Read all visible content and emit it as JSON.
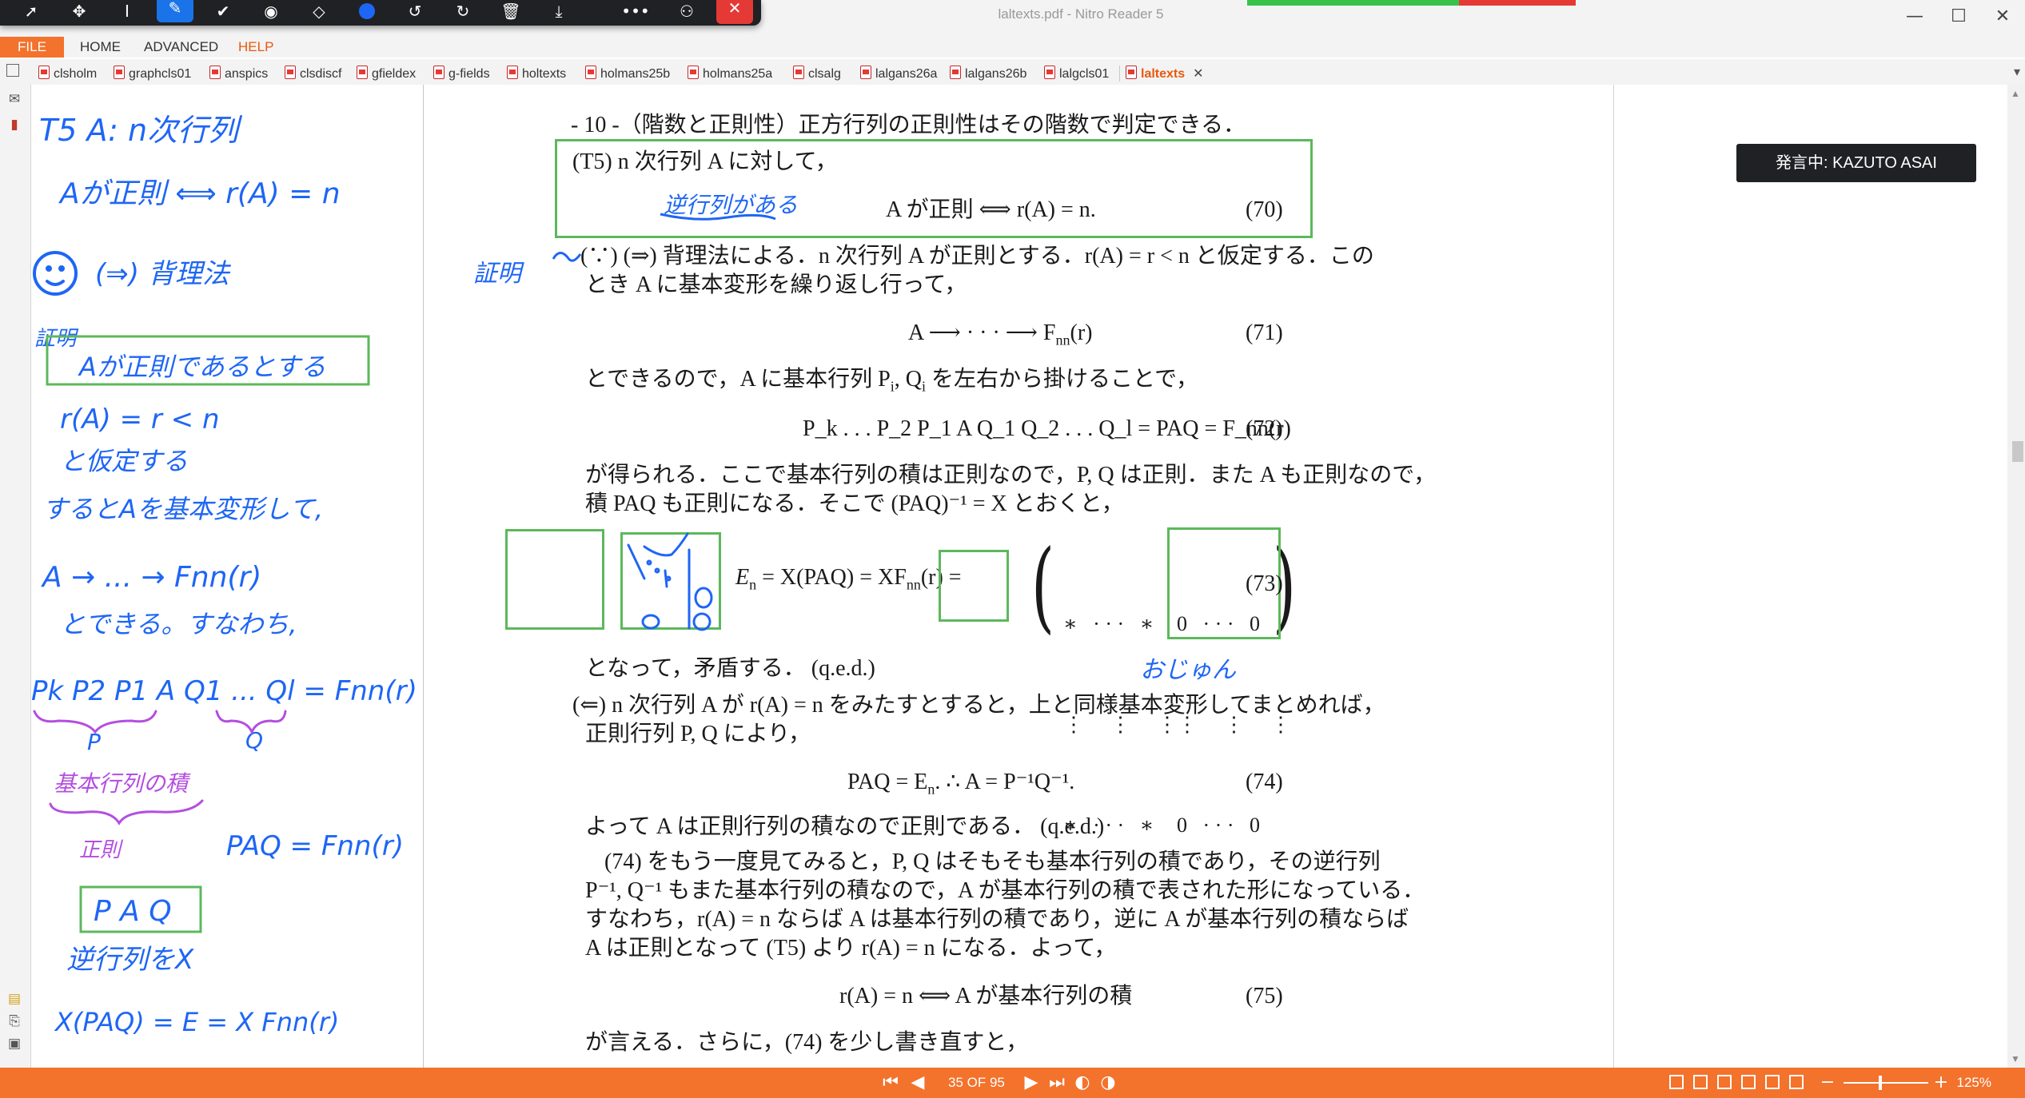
{
  "window": {
    "title": "laltexts.pdf - Nitro Reader 5",
    "controls": [
      "—",
      "☐",
      "✕"
    ]
  },
  "floating_toolbar": {
    "tools": [
      "pointer-tool",
      "move-tool",
      "text-cursor-tool",
      "pen-tool",
      "check-tool",
      "shape-tool",
      "eraser-tool",
      "color-tool",
      "undo-tool",
      "redo-tool",
      "delete-tool",
      "download-tool",
      "more-tool",
      "share-tool",
      "close-tool"
    ],
    "active": "pen-tool"
  },
  "menu": {
    "file": "FILE",
    "home": "HOME",
    "advanced": "ADVANCED",
    "help": "HELP"
  },
  "tabs": [
    {
      "label": "clsholm"
    },
    {
      "label": "graphcls01"
    },
    {
      "label": "anspics"
    },
    {
      "label": "clsdiscf"
    },
    {
      "label": "gfieldex"
    },
    {
      "label": "g-fields"
    },
    {
      "label": "holtexts"
    },
    {
      "label": "holmans25b"
    },
    {
      "label": "holmans25a"
    },
    {
      "label": "clsalg"
    },
    {
      "label": "lalgans26a"
    },
    {
      "label": "lalgans26b"
    },
    {
      "label": "lalgcls01"
    },
    {
      "label": "laltexts",
      "active": true
    }
  ],
  "speaker": "発言中: KAZUTO ASAI",
  "document": {
    "heading": "- 10 -（階数と正則性）正方行列の正則性はその階数で判定できる．",
    "t5_line": "(T5)  n 次行列 A に対して，",
    "eq70_text": "A が正則  ⟺  r(A) = n.",
    "eq70_no": "(70)",
    "proof1a": "(∵)  (⇒)  背理法による．n 次行列 A が正則とする．r(A) = r < n と仮定する．この",
    "proof1b": "とき A に基本変形を繰り返し行って，",
    "eq71_text": "A ⟶ · · · ⟶ F",
    "eq71_sub": "nn",
    "eq71_tail": "(r)",
    "eq71_no": "(71)",
    "line_after71": "とできるので，A に基本行列 P",
    "line_after71_b": "i",
    "line_after71_c": ", Q",
    "line_after71_d": "i",
    "line_after71_e": " を左右から掛けることで，",
    "eq72_text": "P_k . . . P_2 P_1 A Q_1 Q_2 . . . Q_l = PAQ = F_nn(r)",
    "eq72_no": "(72)",
    "line_after72a": "が得られる．ここで基本行列の積は正則なので，P, Q は正則．また A も正則なので，",
    "line_after72b": "積 PAQ も正則になる．そこで (PAQ)⁻¹ = X とおくと，",
    "eq73_lhs": "E",
    "eq73_lhs_sub": "n",
    "eq73_mid": " = X(PAQ) = X",
    "eq73_f": "F",
    "eq73_f_sub": "nn",
    "eq73_f_tail": "(r)",
    "eq73_eq": " =",
    "eq73_no": "(73)",
    "matrix_left": [
      "∗   · · ·   ∗",
      "⋮     ⋮     ⋮",
      "∗   · · ·   ∗"
    ],
    "matrix_right": [
      "0   · · ·   0",
      "⋮     ⋮     ⋮",
      "0   · · ·   0"
    ],
    "contradiction": "となって，矛盾する．  (q.e.d.)",
    "converse_a": "(⇐)  n 次行列 A が r(A) = n をみたすとすると，上と同様基本変形してまとめれば，",
    "converse_b": "正則行列 P, Q により，",
    "eq74_text": "PAQ = E",
    "eq74_sub": "n",
    "eq74_tail": ".        ∴  A = P⁻¹Q⁻¹.",
    "eq74_no": "(74)",
    "qed2": "よって A は正則行列の積なので正則である．  (q.e.d.)",
    "para_a": "(74) をもう一度見てみると，P, Q はそもそも基本行列の積であり，その逆行列",
    "para_b": "P⁻¹, Q⁻¹ もまた基本行列の積なので，A が基本行列の積で表された形になっている．",
    "para_c": "すなわち，r(A) = n ならば A は基本行列の積であり，逆に A が基本行列の積ならば",
    "para_d": "A は正則となって (T5) より r(A) = n になる．よって，",
    "eq75_text": "r(A) = n  ⟺  A が基本行列の積",
    "eq75_no": "(75)",
    "last": "が言える．さらに，(74) を少し書き直すと，"
  },
  "handwriting": {
    "doc_notes": [
      "逆行列がある",
      "証明",
      "おじゅん"
    ],
    "board_lines": [
      "T5  A: n次行列",
      "Aが正則 ⟺ r(A) = n",
      "(⇒) 背理法",
      "証明",
      "Aが正則であるとする",
      "r(A) = r < n",
      "と仮定する",
      "するとAを基本変形して,",
      "A → ... → Fnn(r)",
      "とできる。すなわち,",
      "Pk  P2 P1 A Q1 ... Ql  = Fnn(r)",
      "P",
      "Q",
      "基本行列の積",
      "正則",
      "PAQ = Fnn(r)",
      "逆行列をX",
      "X(PAQ) = E = X Fnn(r)"
    ]
  },
  "statusbar": {
    "page": "35 OF 95",
    "zoom": "125%"
  },
  "colors": {
    "accent": "#f3722c",
    "ink_blue": "#1e66f5",
    "ink_purple": "#b44ee0",
    "box_green": "#5cb85c"
  }
}
